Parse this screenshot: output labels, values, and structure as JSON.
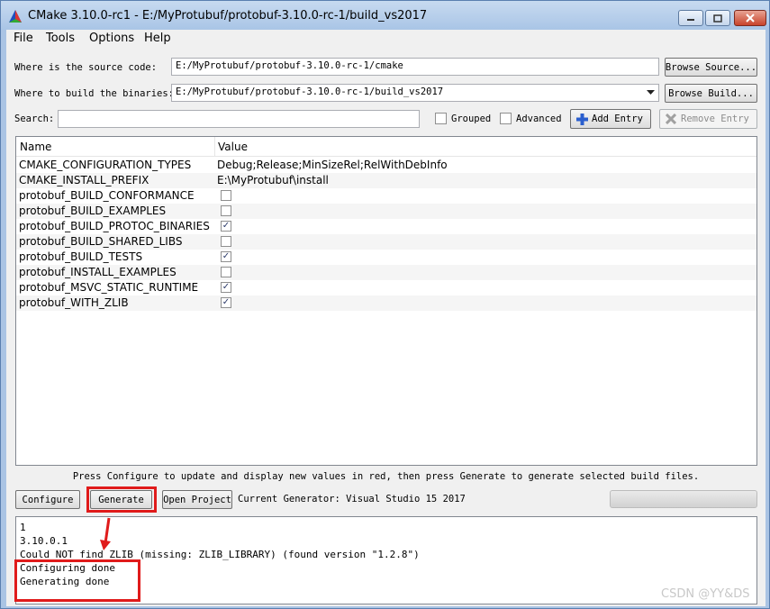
{
  "window": {
    "title": "CMake 3.10.0-rc1 - E:/MyProtubuf/protobuf-3.10.0-rc-1/build_vs2017"
  },
  "menu": [
    "File",
    "Tools",
    "Options",
    "Help"
  ],
  "source": {
    "label": "Where is the source code:",
    "value": "E:/MyProtubuf/protobuf-3.10.0-rc-1/cmake",
    "button": "Browse Source..."
  },
  "build": {
    "label": "Where to build the binaries:",
    "value": "E:/MyProtubuf/protobuf-3.10.0-rc-1/build_vs2017",
    "button": "Browse Build..."
  },
  "search": {
    "label": "Search:",
    "value": "",
    "grouped_label": "Grouped",
    "grouped_checked": false,
    "advanced_label": "Advanced",
    "advanced_checked": false,
    "add_entry": "Add Entry",
    "remove_entry": "Remove Entry"
  },
  "table": {
    "headers": [
      "Name",
      "Value"
    ],
    "rows": [
      {
        "name": "CMAKE_CONFIGURATION_TYPES",
        "type": "text",
        "value": "Debug;Release;MinSizeRel;RelWithDebInfo"
      },
      {
        "name": "CMAKE_INSTALL_PREFIX",
        "type": "text",
        "value": "E:\\MyProtubuf\\install"
      },
      {
        "name": "protobuf_BUILD_CONFORMANCE",
        "type": "bool",
        "checked": false
      },
      {
        "name": "protobuf_BUILD_EXAMPLES",
        "type": "bool",
        "checked": false
      },
      {
        "name": "protobuf_BUILD_PROTOC_BINARIES",
        "type": "bool",
        "checked": true
      },
      {
        "name": "protobuf_BUILD_SHARED_LIBS",
        "type": "bool",
        "checked": false
      },
      {
        "name": "protobuf_BUILD_TESTS",
        "type": "bool",
        "checked": true
      },
      {
        "name": "protobuf_INSTALL_EXAMPLES",
        "type": "bool",
        "checked": false
      },
      {
        "name": "protobuf_MSVC_STATIC_RUNTIME",
        "type": "bool",
        "checked": true
      },
      {
        "name": "protobuf_WITH_ZLIB",
        "type": "bool",
        "checked": true
      }
    ]
  },
  "hint": "Press Configure to update and display new values in red, then press Generate to generate selected build files.",
  "actions": {
    "configure": "Configure",
    "generate": "Generate",
    "open_project": "Open Project",
    "current_generator": "Current Generator: Visual Studio 15 2017"
  },
  "output": [
    "1",
    "3.10.0.1",
    "Could NOT find ZLIB (missing: ZLIB_LIBRARY) (found version \"1.2.8\")",
    "Configuring done",
    "Generating done"
  ],
  "watermark": "CSDN @YY&DS",
  "colors": {
    "highlight": "#e01b1b",
    "title_bar": "#a9c5e6"
  }
}
